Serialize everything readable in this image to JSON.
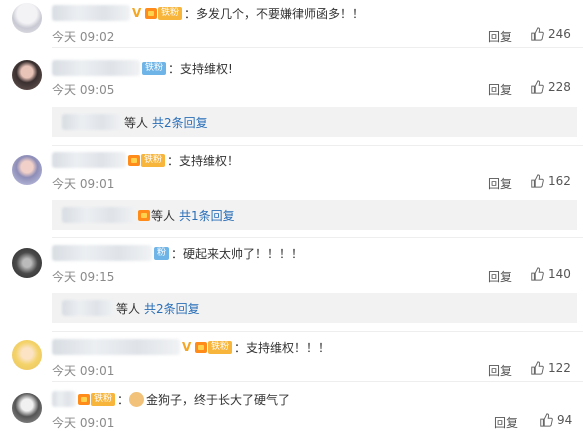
{
  "comments": [
    {
      "content": "：多发几个，不要嫌律师函多！！",
      "fan_label": "铁粉",
      "time": "今天 09:02",
      "reply": "回复",
      "likes": "246"
    },
    {
      "content": "：支持维权!",
      "fan_label": "铁粉",
      "time": "今天 09:05",
      "reply": "回复",
      "likes": "228",
      "sub": {
        "suffix": "等人",
        "link": "共2条回复"
      }
    },
    {
      "content": "：支持维权！",
      "fan_label": "铁粉",
      "time": "今天 09:01",
      "reply": "回复",
      "likes": "162",
      "sub": {
        "suffix": "等人",
        "link": "共1条回复"
      }
    },
    {
      "content": "：硬起来太帅了！！！！",
      "fan_label": "粉",
      "time": "今天 09:15",
      "reply": "回复",
      "likes": "140",
      "sub": {
        "suffix": "等人",
        "link": "共2条回复"
      }
    },
    {
      "content": "：支持维权！！！",
      "fan_label": "铁粉",
      "time": "今天 09:01",
      "reply": "回复",
      "likes": "122"
    },
    {
      "content": "金狗子，终于长大了硬气了",
      "fan_label": "铁粉",
      "time": "今天 09:01",
      "reply": "回复",
      "likes": "94"
    }
  ],
  "icons": {
    "like": "thumbs-up-icon",
    "verified": "verified-v-icon",
    "crown": "crown-icon",
    "emoji": "fist-emoji-icon"
  },
  "colors": {
    "link": "#2a6fb8",
    "fan_badge": "#f7b53c",
    "fan_badge_blue": "#6fb4e6",
    "verified": "#f5a623"
  }
}
